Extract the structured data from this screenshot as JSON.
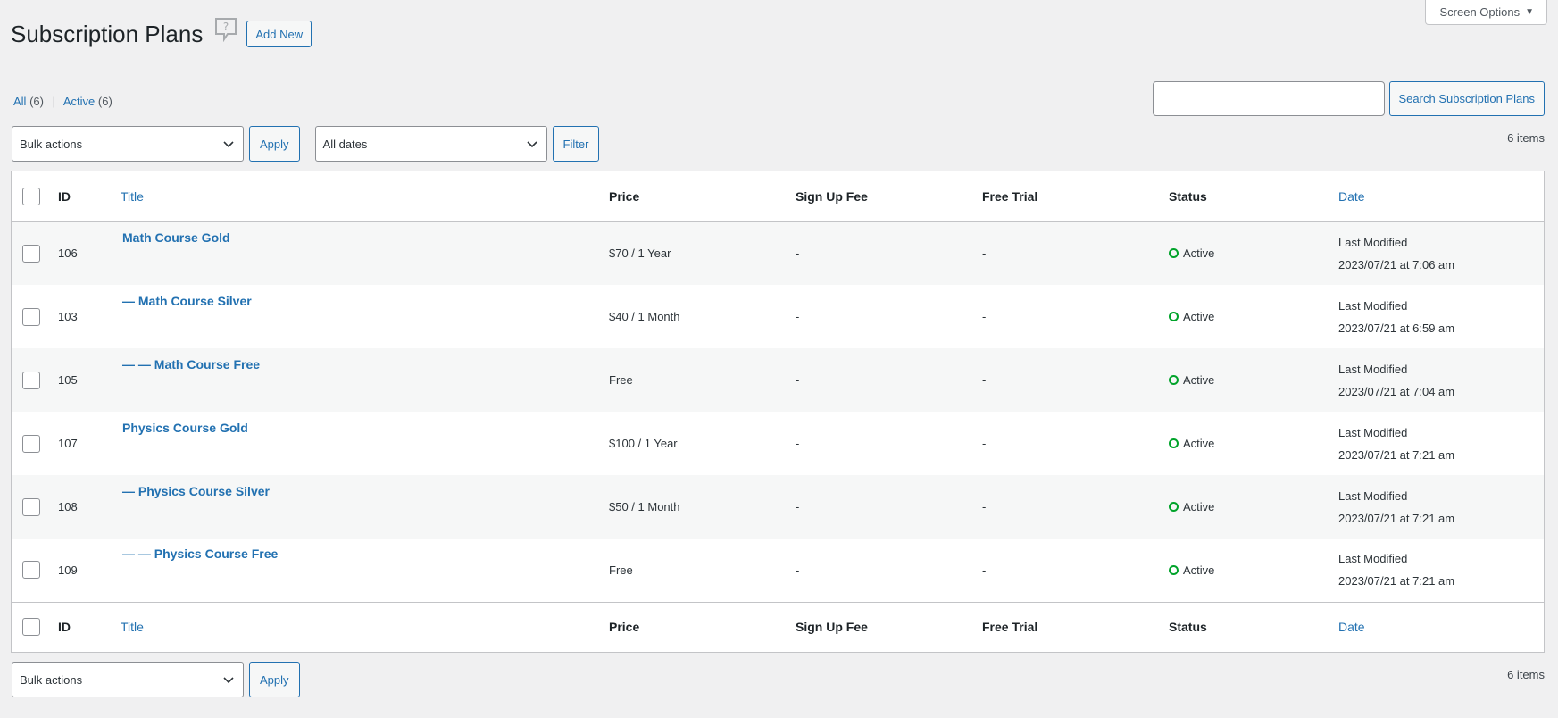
{
  "screen_options": {
    "label": "Screen Options"
  },
  "header": {
    "title": "Subscription Plans",
    "add_new": "Add New"
  },
  "filters": {
    "all_label": "All",
    "all_count": "(6)",
    "active_label": "Active",
    "active_count": "(6)"
  },
  "search": {
    "button": "Search Subscription Plans",
    "value": ""
  },
  "tablenav_top": {
    "bulk_select": "Bulk actions",
    "apply": "Apply",
    "date_select": "All dates",
    "filter": "Filter",
    "items": "6 items"
  },
  "tablenav_bottom": {
    "bulk_select": "Bulk actions",
    "apply": "Apply",
    "items": "6 items"
  },
  "columns": {
    "id": "ID",
    "title": "Title",
    "price": "Price",
    "signup": "Sign Up Fee",
    "trial": "Free Trial",
    "status": "Status",
    "date": "Date"
  },
  "rows": [
    {
      "id": "106",
      "title": "Math Course Gold",
      "price": "$70 / 1 Year",
      "signup": "-",
      "trial": "-",
      "status": "Active",
      "date_label": "Last Modified",
      "date": "2023/07/21 at 7:06 am"
    },
    {
      "id": "103",
      "title": "— Math Course Silver",
      "price": "$40 / 1 Month",
      "signup": "-",
      "trial": "-",
      "status": "Active",
      "date_label": "Last Modified",
      "date": "2023/07/21 at 6:59 am"
    },
    {
      "id": "105",
      "title": "— — Math Course Free",
      "price": "Free",
      "signup": "-",
      "trial": "-",
      "status": "Active",
      "date_label": "Last Modified",
      "date": "2023/07/21 at 7:04 am"
    },
    {
      "id": "107",
      "title": "Physics Course Gold",
      "price": "$100 / 1 Year",
      "signup": "-",
      "trial": "-",
      "status": "Active",
      "date_label": "Last Modified",
      "date": "2023/07/21 at 7:21 am"
    },
    {
      "id": "108",
      "title": "— Physics Course Silver",
      "price": "$50 / 1 Month",
      "signup": "-",
      "trial": "-",
      "status": "Active",
      "date_label": "Last Modified",
      "date": "2023/07/21 at 7:21 am"
    },
    {
      "id": "109",
      "title": "— — Physics Course Free",
      "price": "Free",
      "signup": "-",
      "trial": "-",
      "status": "Active",
      "date_label": "Last Modified",
      "date": "2023/07/21 at 7:21 am"
    }
  ],
  "colors": {
    "accent": "#2271b1",
    "active_status": "#00a32a",
    "background": "#f0f0f1"
  },
  "icons": {
    "help": "help-speech-bubble-icon",
    "select_arrow": "chevron-down-icon",
    "status": "circle-outline-icon"
  }
}
